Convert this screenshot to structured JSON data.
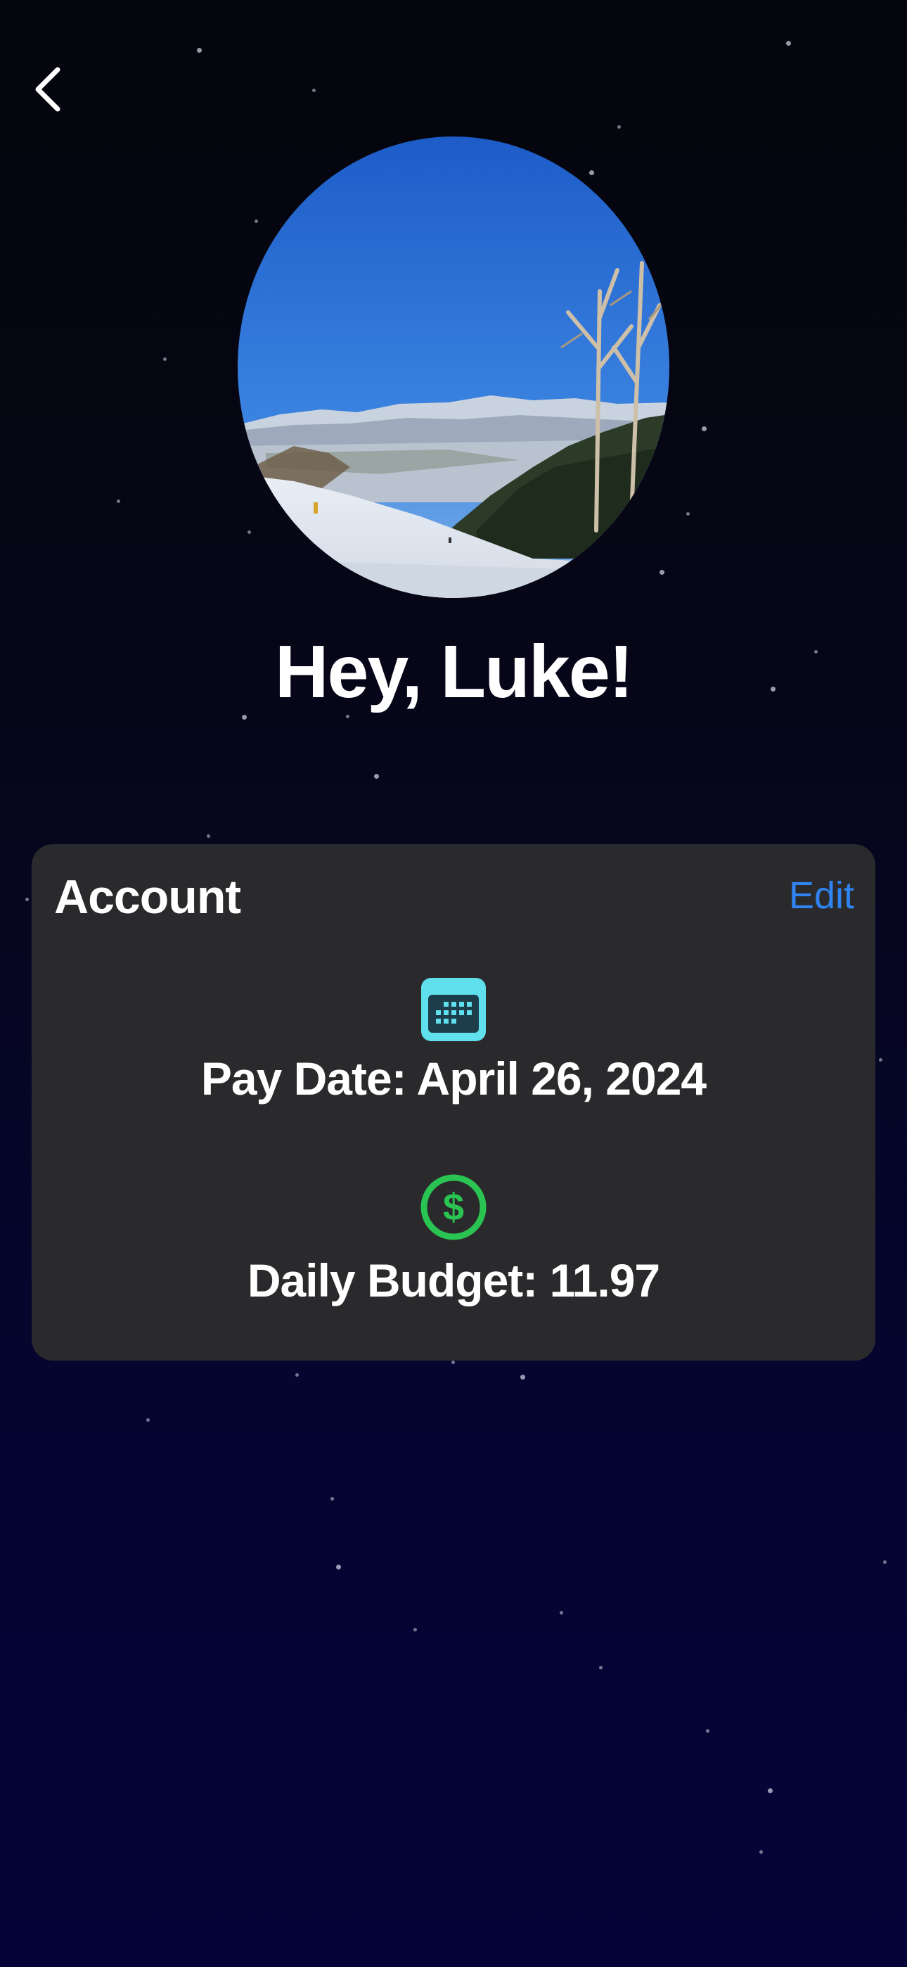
{
  "nav": {
    "back_icon": "chevron-left-icon"
  },
  "profile": {
    "avatar_alt": "Profile photo",
    "greeting": "Hey, Luke!"
  },
  "account": {
    "title": "Account",
    "edit_label": "Edit",
    "pay_date": {
      "icon": "calendar-icon",
      "text": "Pay Date: April 26, 2024"
    },
    "daily_budget": {
      "icon": "dollar-circle-icon",
      "text": "Daily Budget: 11.97"
    }
  },
  "colors": {
    "background_top": "#05050c",
    "background_bottom": "#040438",
    "card": "#2a2a2c",
    "accent_blue": "#2f84f2",
    "calendar_teal": "#5fe0ec",
    "dollar_green": "#2ac452"
  }
}
